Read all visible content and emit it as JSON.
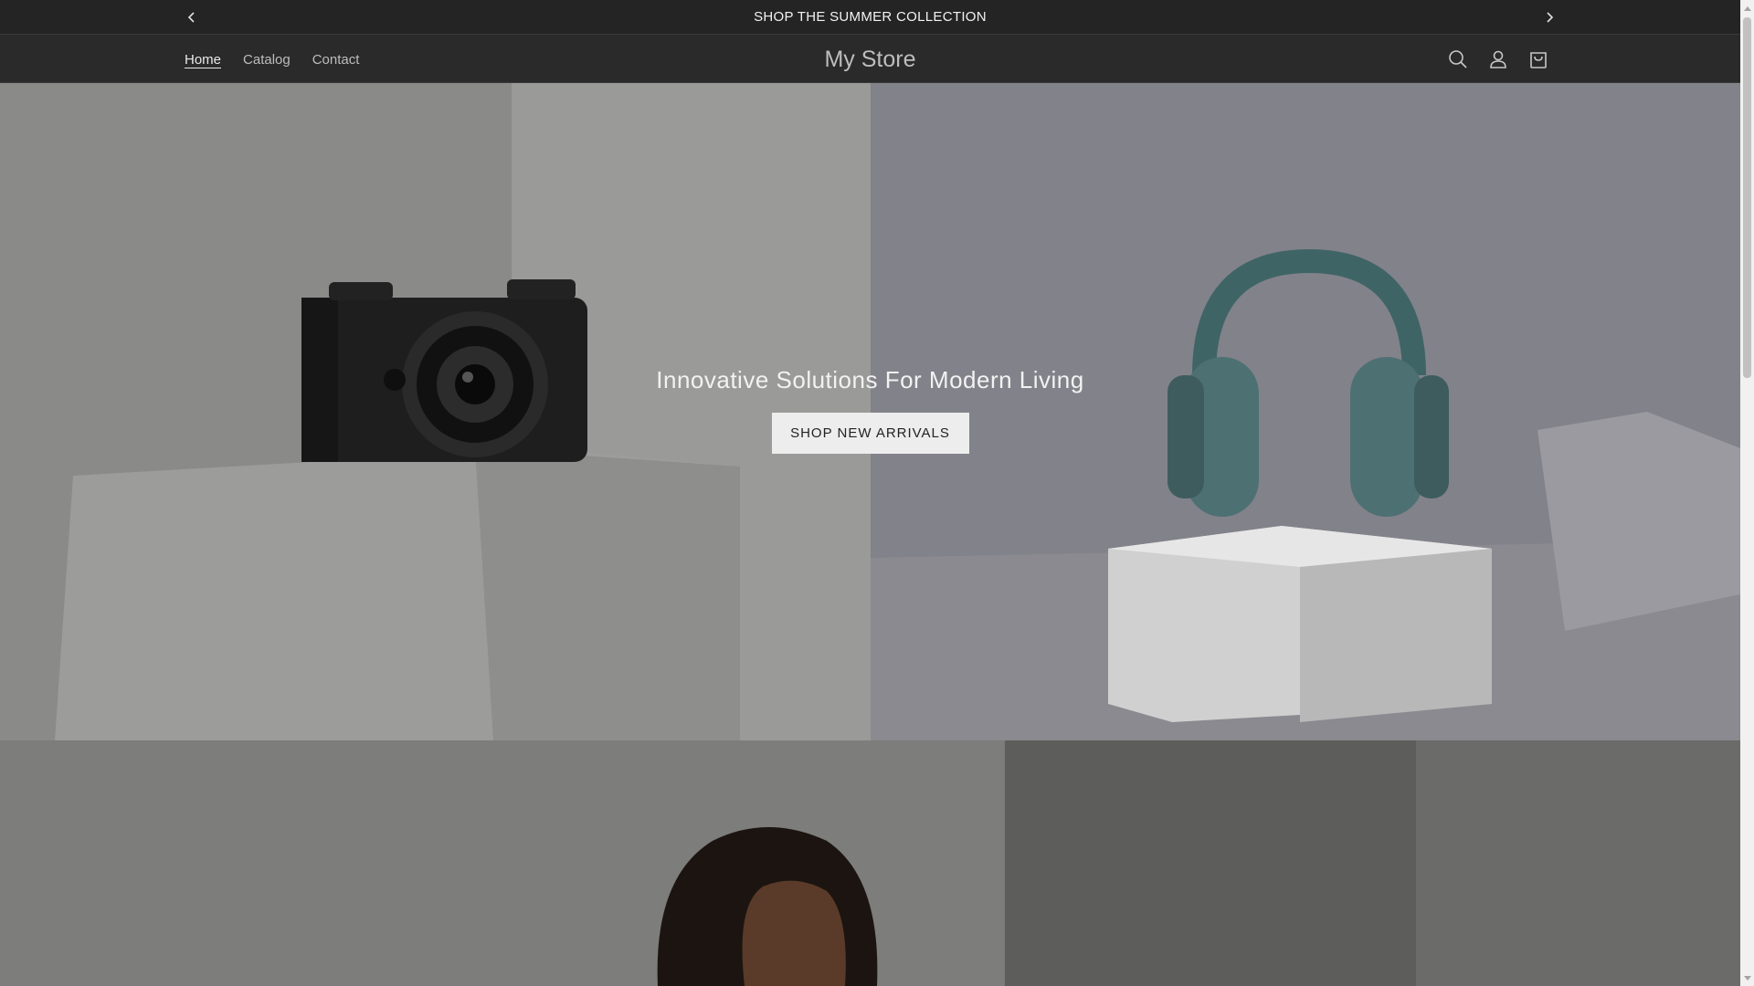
{
  "announcement": {
    "text": "SHOP THE SUMMER COLLECTION",
    "prev_icon": "chevron-left-icon",
    "next_icon": "chevron-right-icon"
  },
  "header": {
    "nav": [
      {
        "label": "Home",
        "active": true
      },
      {
        "label": "Catalog",
        "active": false
      },
      {
        "label": "Contact",
        "active": false
      }
    ],
    "logo": "My Store",
    "icons": [
      "search-icon",
      "account-icon",
      "cart-icon"
    ]
  },
  "hero": {
    "title": "Innovative Solutions For Modern Living",
    "button_label": "SHOP NEW ARRIVALS"
  },
  "colors": {
    "announcement_bg": "#242424",
    "header_bg": "#2a2a2a",
    "accent_teal": "#3e5c5e"
  }
}
